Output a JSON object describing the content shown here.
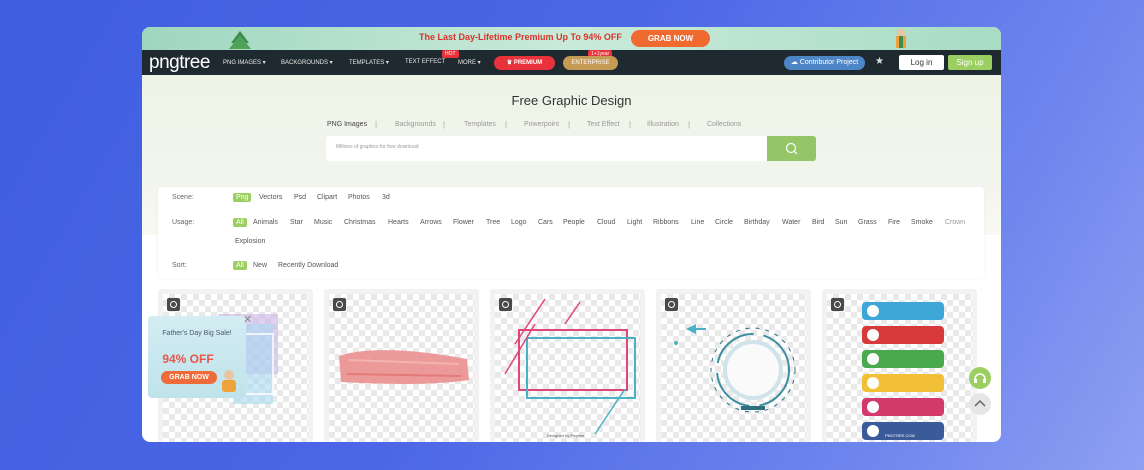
{
  "promo": {
    "text": "The Last Day-Lifetime Premium Up To 94% OFF",
    "button": "GRAB NOW"
  },
  "nav": {
    "logo": "pngtree",
    "items": [
      "PNG IMAGES",
      "BACKGROUNDS",
      "TEMPLATES",
      "TEXT EFFECT",
      "MORE"
    ],
    "hot_badge": "HOT",
    "premium": "PREMIUM",
    "enterprise": "ENTERPRISE",
    "enterprise_badge": "1+1year",
    "contributor": "Contributor Project",
    "login": "Log in",
    "signup": "Sign up"
  },
  "hero": {
    "title": "Free Graphic Design",
    "tabs": [
      "PNG Images",
      "Backgrounds",
      "Templates",
      "Powerpoint",
      "Text Effect",
      "Illustration",
      "Collections"
    ],
    "search_placeholder": "Millions of graphics for free download"
  },
  "filters": {
    "scene_label": "Scene:",
    "scene": [
      "Png",
      "Vectors",
      "Psd",
      "Clipart",
      "Photos",
      "3d"
    ],
    "usage_label": "Usage:",
    "usage": [
      "All",
      "Animals",
      "Star",
      "Music",
      "Christmas",
      "Hearts",
      "Arrows",
      "Flower",
      "Tree",
      "Logo",
      "Cars",
      "People",
      "Cloud",
      "Light",
      "Ribbons",
      "Line",
      "Circle",
      "Birthday",
      "Water",
      "Bird",
      "Sun",
      "Grass",
      "Fire",
      "Smoke",
      "Crown",
      "Explosion"
    ],
    "sort_label": "Sort:",
    "sort": [
      "All",
      "New",
      "Recently Download"
    ]
  },
  "cards": {
    "caption_frame": "Designed by Pngtree",
    "caption_social": "PNGTREE.COM"
  },
  "popup": {
    "title": "Father's Day Big Sale!",
    "percent": "94% OFF",
    "button": "GRAB NOW"
  },
  "colors": {
    "accent_green": "#9ccf62",
    "nav_bg": "#1f2a30",
    "promo_red": "#d8322b",
    "premium_red": "#e8333c"
  }
}
